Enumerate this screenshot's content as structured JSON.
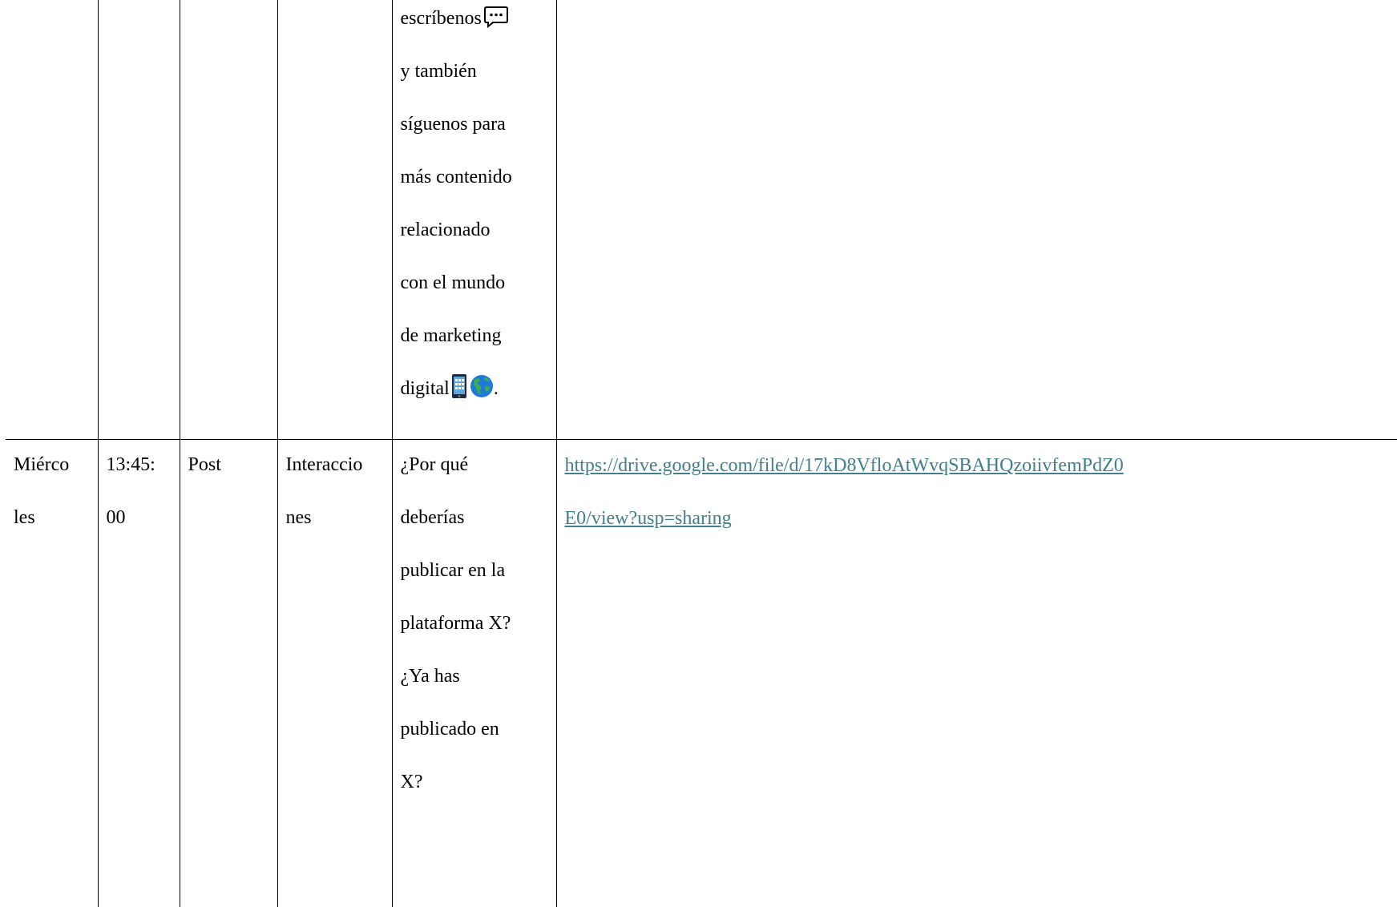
{
  "table": {
    "row_continuation": {
      "message_lines": [
        "escríbenos",
        "y también",
        "síguenos para",
        "más contenido",
        "relacionado",
        "con el mundo",
        "de marketing",
        "digital"
      ],
      "message_end": "."
    },
    "row_wednesday": {
      "day_line1": "Miérco",
      "day_line2": "les",
      "time_line1": "13:45:",
      "time_line2": "00",
      "format": "Post",
      "objective_line1": "Interaccio",
      "objective_line2": "nes",
      "message_lines": [
        "¿Por qué",
        "deberías",
        "publicar en la",
        "plataforma X?",
        "¿Ya has",
        "publicado en",
        "X?"
      ],
      "link_line1": "https://drive.google.com/file/d/17kD8VfloAtWvqSBAHQzoiivfemPdZ0",
      "link_line2": "E0/view?usp=sharing"
    }
  },
  "icons": {
    "chat": "speech-bubble-icon",
    "phone": "mobile-phone-icon",
    "globe": "globe-americas-icon"
  },
  "colors": {
    "link": "#3f7f8f",
    "border": "#000000",
    "text": "#000000"
  }
}
